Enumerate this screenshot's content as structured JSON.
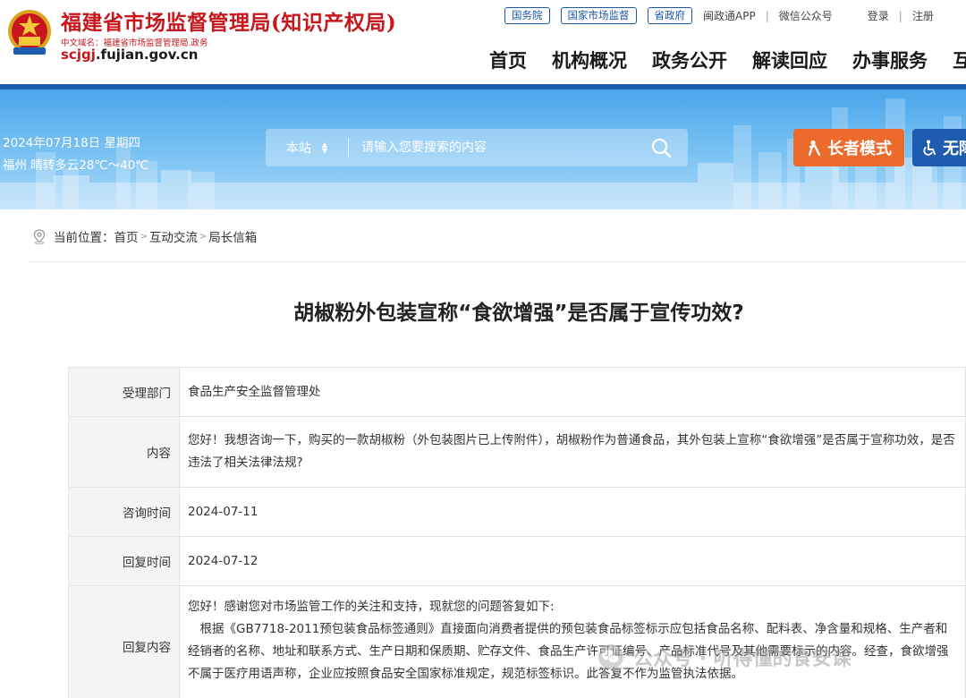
{
  "header": {
    "site_title": "福建省市场监督管理局(知识产权局)",
    "cn_domain": "中文域名：福建省市场监督管理局.政务",
    "domain_prefix": "scjgj",
    "domain_suffix": ".fujian.gov.cn",
    "top_links": {
      "state_council": "国务院",
      "samr": "国家市场监督",
      "province_gov": "省政府",
      "app": "闽政通APP",
      "wechat": "微信公众号",
      "login": "登录",
      "register": "注册"
    },
    "nav": [
      "首页",
      "机构概况",
      "政务公开",
      "解读回应",
      "办事服务",
      "互"
    ]
  },
  "banner": {
    "date": "2024年07月18日 星期四",
    "weather": "福州 晴转多云28℃～40℃",
    "search": {
      "scope": "本站",
      "placeholder": "请输入您要搜索的内容"
    },
    "elder_mode": "长者模式",
    "accessibility": "无障"
  },
  "breadcrumb": {
    "label": "当前位置：",
    "items": [
      "首页",
      "互动交流",
      "局长信箱"
    ],
    "sep": ">"
  },
  "article": {
    "title": "胡椒粉外包装宣称“食欲增强”是否属于宣传功效?",
    "rows": {
      "department": {
        "label": "受理部门",
        "value": "食品生产安全监督管理处"
      },
      "content": {
        "label": "内容",
        "value": "您好！我想咨询一下，购买的一款胡椒粉（外包装图片已上传附件），胡椒粉作为普通食品，其外包装上宣称“食欲增强”是否属于宣称功效，是否违法了相关法律法规?"
      },
      "ask_time": {
        "label": "咨询时间",
        "value": "2024-07-11"
      },
      "reply_time": {
        "label": "回复时间",
        "value": "2024-07-12"
      },
      "reply": {
        "label": "回复内容",
        "line1": "您好！感谢您对市场监管工作的关注和支持，现就您的问题答复如下:",
        "line2": "根据《GB7718-2011预包装食品标签通则》直接面向消费者提供的预包装食品标签标示应包括食品名称、配料表、净含量和规格、生产者和经销者的名称、地址和联系方式、生产日期和保质期、贮存文件、食品生产许可证编号、产品标准代号及其他需要标示的内容。经查，食欲增强不属于医疗用语声称，企业应按照食品安全国家标准规定，规范标签标识。此答复不作为监管执法依据。"
      }
    }
  },
  "watermark": "公众号 · 听得懂的食安课",
  "colors": {
    "brand_red": "#c8161d",
    "brand_blue": "#1d5cae",
    "elder_orange": "#ec6a2c"
  }
}
